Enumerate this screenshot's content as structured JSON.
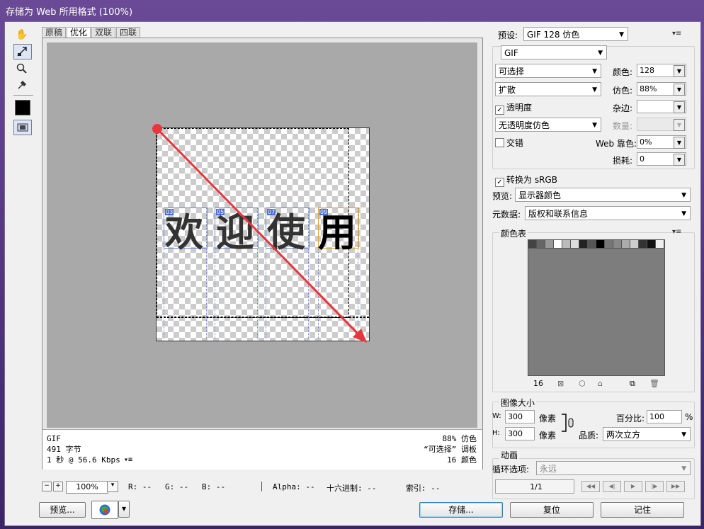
{
  "window": {
    "title": "存储为 Web 所用格式 (100%)"
  },
  "toolbox": {
    "tools": [
      "hand-tool",
      "slice-select-tool",
      "zoom-tool",
      "eyedropper-tool"
    ],
    "swatch_color": "#000000"
  },
  "tabs": [
    "原稿",
    "优化",
    "双联",
    "四联"
  ],
  "canvas": {
    "glyphs": [
      "欢",
      "迎",
      "使",
      "用"
    ],
    "slice_tags": [
      "03",
      "05",
      "07",
      "09"
    ],
    "annotation_color": "#e8363c"
  },
  "info": {
    "left": [
      "GIF",
      "491 字节",
      "1 秒 @ 56.6 Kbps"
    ],
    "right": [
      "88% 仿色",
      "“可选择” 调板",
      "16 颜色"
    ]
  },
  "statusbar": {
    "zoom": "100%",
    "r": "R: --",
    "g": "G: --",
    "b": "B: --",
    "alpha": "Alpha: --",
    "hex": "十六进制: --",
    "index": "索引: --"
  },
  "buttons": {
    "preview": "预览...",
    "save": "存储...",
    "reset": "复位",
    "remember": "记住"
  },
  "preset": {
    "label": "预设:",
    "value": "GIF 128 仿色"
  },
  "format": "GIF",
  "reduction": "可选择",
  "dither_algo": "扩散",
  "transparency": {
    "label": "透明度",
    "checked": true
  },
  "transparency_dither": "无透明度仿色",
  "interlaced": {
    "label": "交错",
    "checked": false
  },
  "colors": {
    "label": "颜色:",
    "value": "128"
  },
  "dither": {
    "label": "仿色:",
    "value": "88%"
  },
  "matte": {
    "label": "杂边:",
    "value": ""
  },
  "amount": {
    "label": "数量:",
    "value": ""
  },
  "web_snap": {
    "label": "Web 靠色:",
    "value": "0%"
  },
  "lossy": {
    "label": "损耗:",
    "value": "0"
  },
  "srgb": {
    "label": "转换为 sRGB",
    "checked": true
  },
  "preview_mode": {
    "label": "预览:",
    "value": "显示器颜色"
  },
  "metadata": {
    "label": "元数据:",
    "value": "版权和联系信息"
  },
  "color_table": {
    "title": "颜色表",
    "count": "16",
    "swatches": [
      "#444",
      "#666",
      "#999",
      "#fff",
      "#bbb",
      "#ddd",
      "#222",
      "#555",
      "#000",
      "#777",
      "#888",
      "#aaa",
      "#ccc",
      "#333",
      "#111",
      "#eee"
    ]
  },
  "image_size": {
    "title": "图像大小",
    "w_label": "W:",
    "w": "300",
    "h_label": "H:",
    "h": "300",
    "unit": "像素",
    "percent_label": "百分比:",
    "percent": "100",
    "percent_unit": "%",
    "quality_label": "品质:",
    "quality": "两次立方"
  },
  "animation": {
    "title": "动画",
    "loop_label": "循环选项:",
    "loop": "永远",
    "frame": "1/1"
  }
}
